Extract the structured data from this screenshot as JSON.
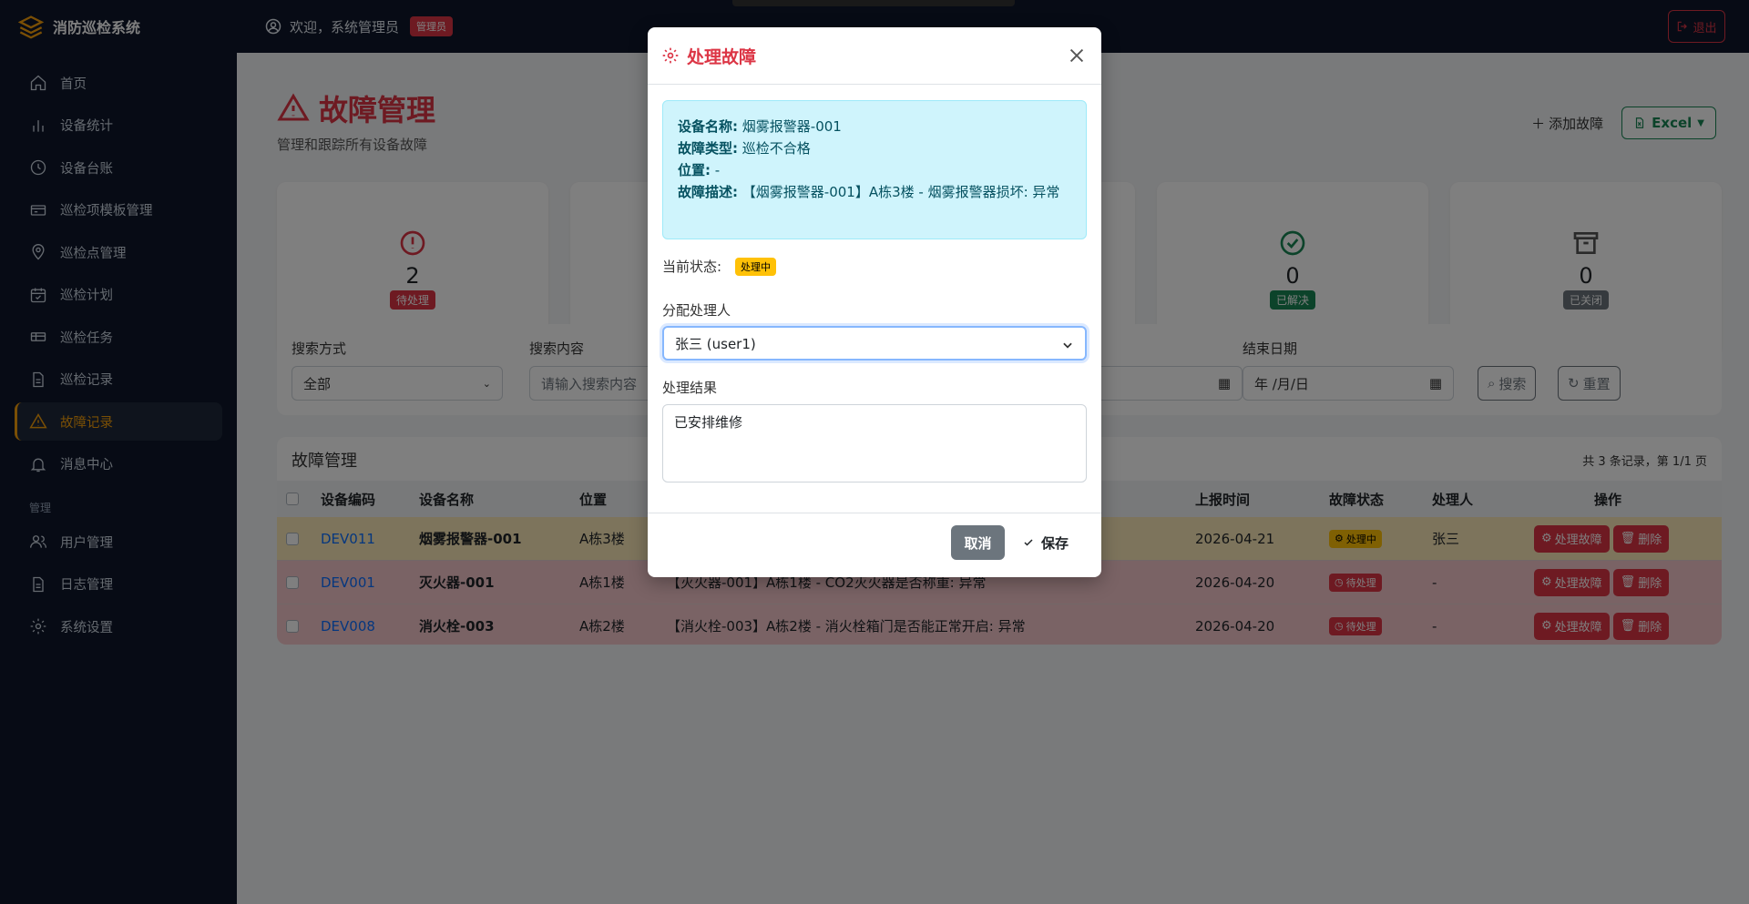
{
  "app": {
    "name": "消防巡检系统"
  },
  "topbar": {
    "welcome": "欢迎，系统管理员",
    "role": "管理员",
    "logout": "退出"
  },
  "sidebar": {
    "items": [
      {
        "label": "首页",
        "icon": "home-icon"
      },
      {
        "label": "设备统计",
        "icon": "bar-chart-icon"
      },
      {
        "label": "设备台账",
        "icon": "clock-icon"
      },
      {
        "label": "巡检项模板管理",
        "icon": "template-icon"
      },
      {
        "label": "巡检点管理",
        "icon": "map-pin-icon"
      },
      {
        "label": "巡检计划",
        "icon": "calendar-icon"
      },
      {
        "label": "巡检任务",
        "icon": "ticket-icon"
      },
      {
        "label": "巡检记录",
        "icon": "document-icon"
      },
      {
        "label": "故障记录",
        "icon": "warning-icon",
        "active": true
      },
      {
        "label": "消息中心",
        "icon": "bell-icon"
      }
    ],
    "section": "管理",
    "admin_items": [
      {
        "label": "用户管理",
        "icon": "users-icon"
      },
      {
        "label": "日志管理",
        "icon": "log-icon"
      },
      {
        "label": "系统设置",
        "icon": "gear-icon"
      }
    ]
  },
  "page": {
    "title": "故障管理",
    "subtitle": "管理和跟踪所有设备故障",
    "add_label": "添加故障",
    "excel_label": "Excel"
  },
  "stats": [
    {
      "value": "2",
      "label": "待处理",
      "color": "#dc3545"
    },
    {
      "value": "",
      "label": "",
      "color": ""
    },
    {
      "value": "",
      "label": "",
      "color": ""
    },
    {
      "value": "0",
      "label": "已解决",
      "color": "#198754"
    },
    {
      "value": "0",
      "label": "已关闭",
      "color": "#6c757d"
    }
  ],
  "filter": {
    "search_mode_label": "搜索方式",
    "search_mode_value": "全部",
    "search_content_label": "搜索内容",
    "search_content_placeholder": "请输入搜索内容",
    "end_date_label": "结束日期",
    "date_placeholder": "年 /月/日",
    "search_btn": "搜索",
    "reset_btn": "重置"
  },
  "table": {
    "title": "故障管理",
    "info": "共 3 条记录，第 1/1 页",
    "headers": [
      "设备编码",
      "设备名称",
      "位置",
      "上报时间",
      "故障状态",
      "处理人",
      "操作"
    ],
    "rows": [
      {
        "code": "DEV011",
        "name": "烟雾报警器-001",
        "location": "A栋3楼",
        "desc": "",
        "time": "2026-04-21",
        "status": "处理中",
        "handler": "张三",
        "variant": "warning"
      },
      {
        "code": "DEV001",
        "name": "灭火器-001",
        "location": "A栋1楼",
        "desc": "【灭火器-001】A栋1楼 - CO2灭火器是否称重: 异常",
        "time": "2026-04-20",
        "status": "待处理",
        "handler": "-",
        "variant": "danger"
      },
      {
        "code": "DEV008",
        "name": "消火栓-003",
        "location": "A栋2楼",
        "desc": "【消火栓-003】A栋2楼 - 消火栓箱门是否能正常开启: 异常",
        "time": "2026-04-20",
        "status": "待处理",
        "handler": "-",
        "variant": "danger"
      }
    ],
    "action_process": "处理故障",
    "action_delete": "删除"
  },
  "modal": {
    "title": "处理故障",
    "info": {
      "device_name_label": "设备名称:",
      "device_name": "烟雾报警器-001",
      "fault_type_label": "故障类型:",
      "fault_type": "巡检不合格",
      "location_label": "位置:",
      "location": "-",
      "desc_label": "故障描述:",
      "desc": "【烟雾报警器-001】A栋3楼 - 烟雾报警器损坏: 异常"
    },
    "current_status_label": "当前状态:",
    "current_status": "处理中",
    "assign_label": "分配处理人",
    "assign_value": "张三 (user1)",
    "result_label": "处理结果",
    "result_value": "已安排维修",
    "cancel": "取消",
    "save": "保存"
  }
}
